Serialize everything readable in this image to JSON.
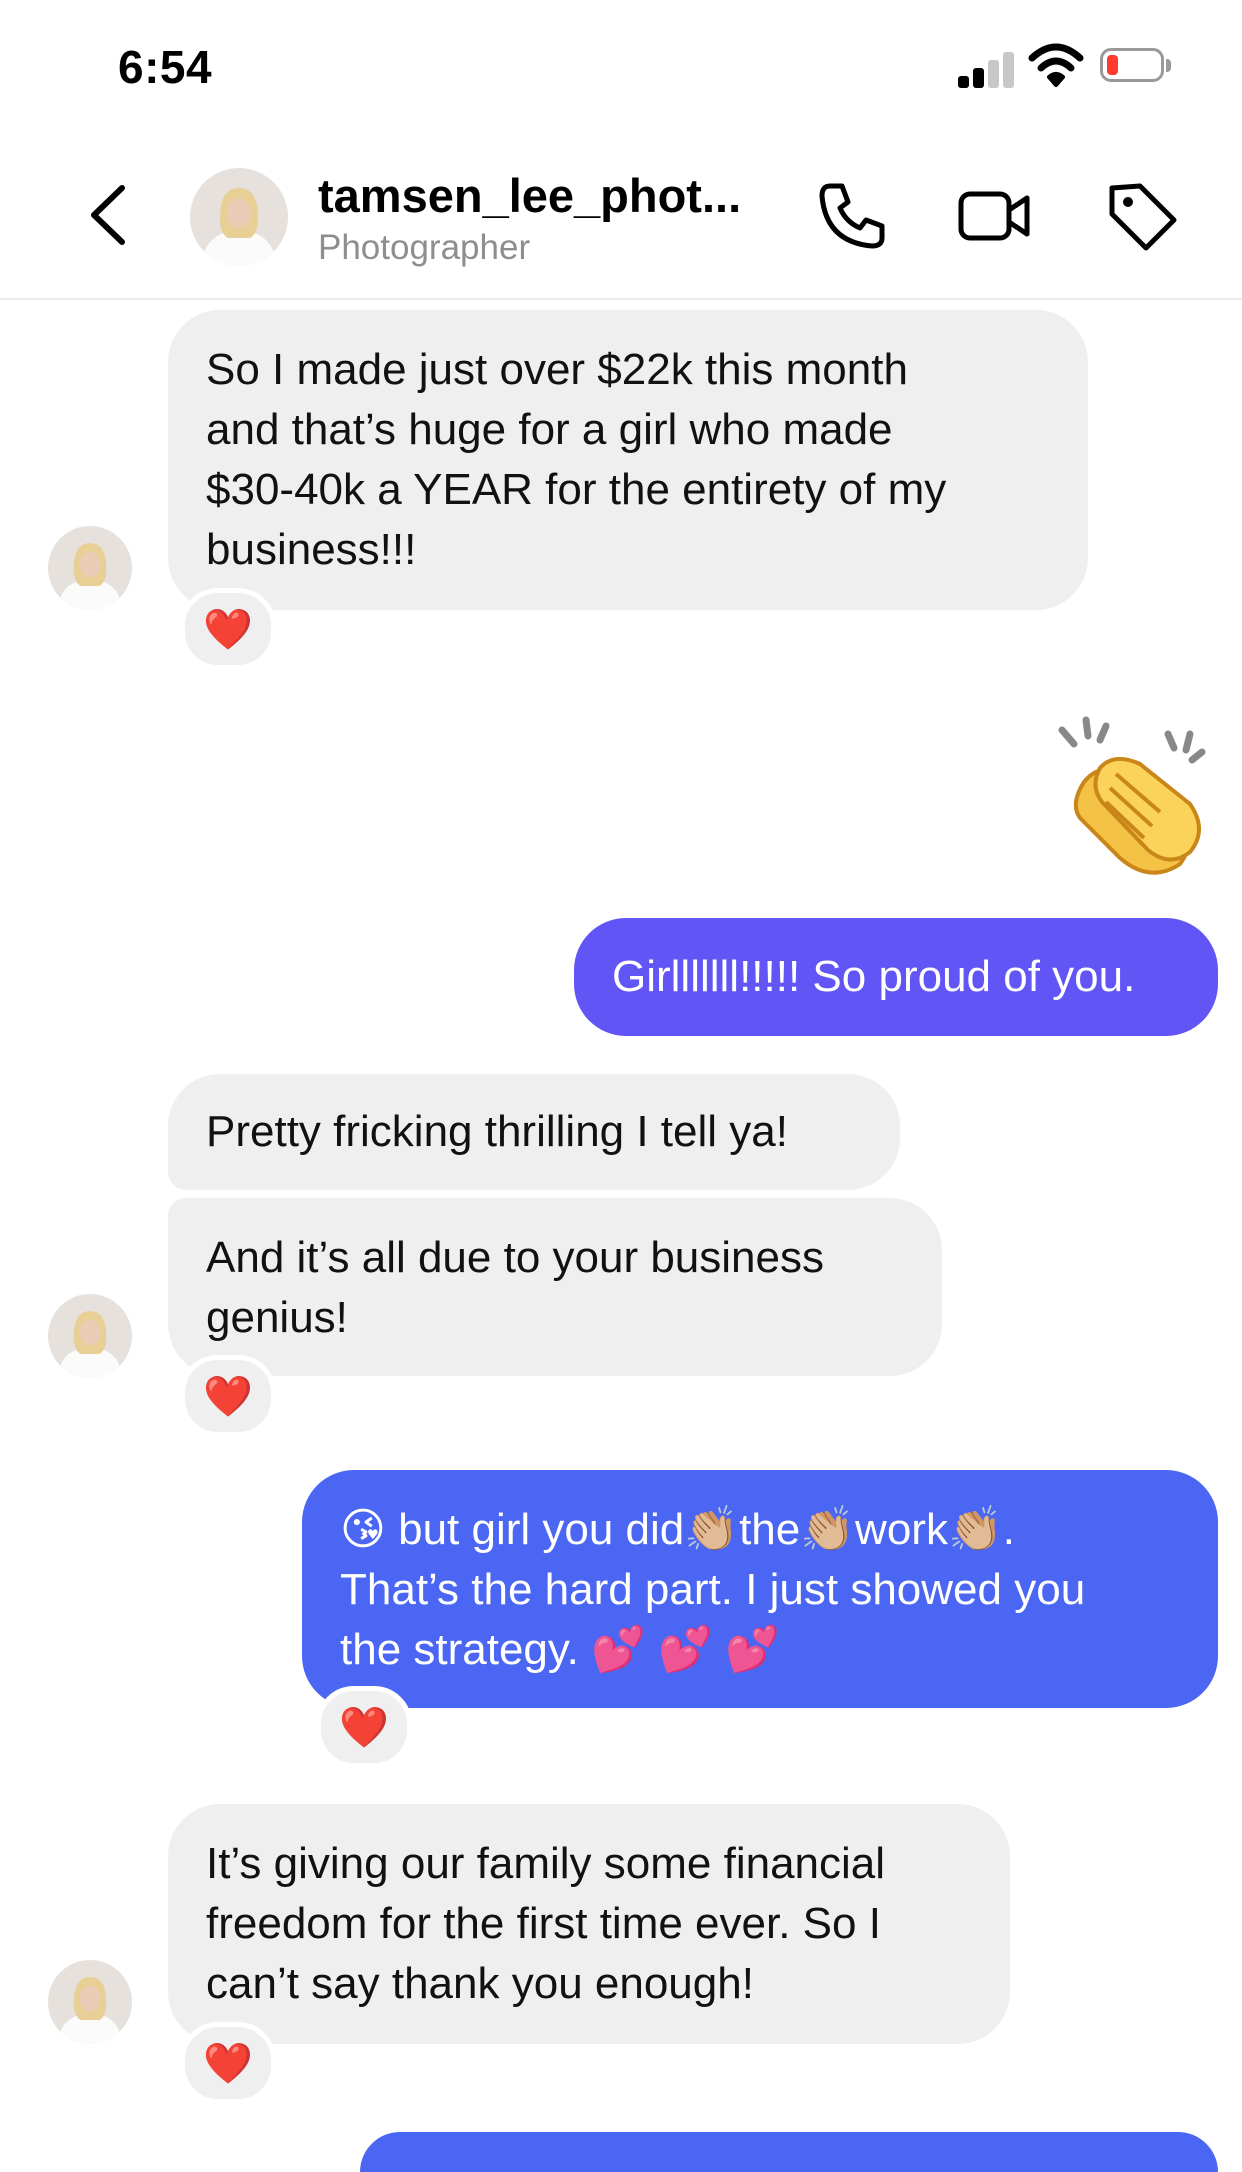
{
  "status_bar": {
    "time": "6:54",
    "battery_color": "#ff3b30"
  },
  "header": {
    "back_icon": "chevron-left-icon",
    "username": "tamsen_lee_phot...",
    "subtitle": "Photographer",
    "icons": [
      "phone-icon",
      "video-camera-icon",
      "tag-icon"
    ]
  },
  "colors": {
    "outgoing_purple": "#6155f5",
    "outgoing_blue": "#4a66f2",
    "incoming": "#efefef"
  },
  "messages": [
    {
      "side": "in",
      "lines": [
        "So I made just over $22k this month",
        "and that’s huge for a girl who made",
        "$30-40k a YEAR for the entirety of my",
        "business!!!"
      ],
      "reaction": "❤️"
    },
    {
      "side": "out",
      "type": "emoji",
      "emoji": "👏"
    },
    {
      "side": "out",
      "lines": [
        "Girlllllll!!!!! So proud of you."
      ]
    },
    {
      "side": "in",
      "lines": [
        "Pretty fricking thrilling I tell ya!"
      ]
    },
    {
      "side": "in",
      "lines": [
        "And it’s all due to your business",
        "genius!"
      ],
      "reaction": "❤️"
    },
    {
      "side": "out",
      "line1": {
        "e1": "😘",
        "t1": " but girl you did",
        "e2": "👏🏼",
        "t2": "the",
        "e3": "👏🏼",
        "t3": "work",
        "e4": "👏🏼",
        "t4": "."
      },
      "lines": [
        "That’s the hard part. I just showed you",
        "the strategy. 💕 💕 💕"
      ],
      "reaction": "❤️"
    },
    {
      "side": "in",
      "lines": [
        "It’s giving our family some financial",
        "freedom for the first time ever. So I",
        "can’t say thank you enough!"
      ],
      "reaction": "❤️"
    }
  ]
}
